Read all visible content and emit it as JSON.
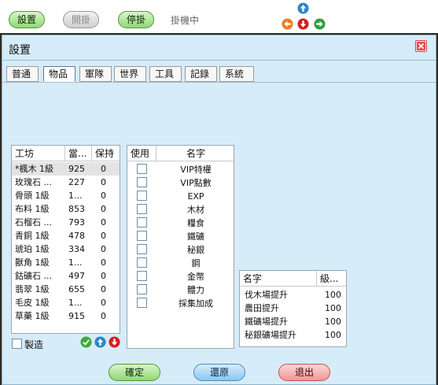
{
  "toolbar": {
    "settings_label": "設置",
    "start_label": "開掛",
    "stop_label": "停掛",
    "status": "掛機中"
  },
  "window": {
    "title": "設置"
  },
  "tabs": [
    {
      "label": "普通"
    },
    {
      "label": "物品"
    },
    {
      "label": "軍隊"
    },
    {
      "label": "世界"
    },
    {
      "label": "工具"
    },
    {
      "label": "記錄"
    },
    {
      "label": "系統"
    }
  ],
  "workshop_table": {
    "headers": [
      "工坊",
      "當...",
      "保持"
    ],
    "rows": [
      [
        "*楓木 1級",
        "925",
        "0"
      ],
      [
        "玫瑰石 ...",
        "227",
        "0"
      ],
      [
        "骨頭 1級",
        "1...",
        "0"
      ],
      [
        "布料 1級",
        "853",
        "0"
      ],
      [
        "石榴石 ...",
        "793",
        "0"
      ],
      [
        "青銅 1級",
        "478",
        "0"
      ],
      [
        "琥珀 1級",
        "334",
        "0"
      ],
      [
        "獸角 1級",
        "1...",
        "0"
      ],
      [
        "鈷礦石 ...",
        "497",
        "0"
      ],
      [
        "翡翠 1級",
        "655",
        "0"
      ],
      [
        "毛皮 1級",
        "1...",
        "0"
      ],
      [
        "草藥 1級",
        "915",
        "0"
      ]
    ]
  },
  "craft": {
    "label": "製造"
  },
  "use_table": {
    "headers": [
      "使用",
      "名字"
    ],
    "rows": [
      "VIP特權",
      "VIP點數",
      "EXP",
      "木材",
      "糧食",
      "鐵礦",
      "秘銀",
      "鋼",
      "金幣",
      "體力",
      "採集加成"
    ]
  },
  "level_table": {
    "headers": [
      "名字",
      "級..."
    ],
    "rows": [
      [
        "伐木場提升",
        "100"
      ],
      [
        "農田提升",
        "100"
      ],
      [
        "鐵礦場提升",
        "100"
      ],
      [
        "秘銀礦場提升",
        "100"
      ]
    ]
  },
  "footer": {
    "confirm_label": "確定",
    "restore_label": "還原",
    "exit_label": "退出"
  },
  "colors": {
    "window_bg": "#d6ecf8",
    "green_button": "#8fd877",
    "blue_button": "#8cc7ee",
    "red_button": "#f19696"
  }
}
